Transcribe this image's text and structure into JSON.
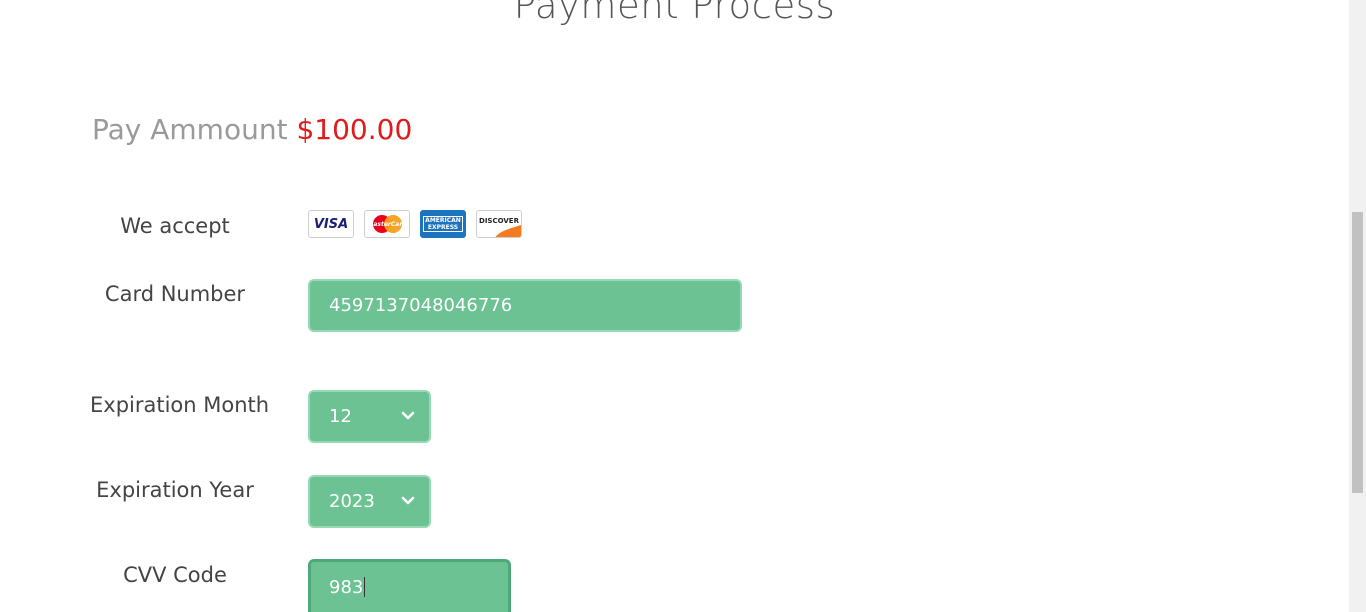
{
  "page": {
    "title": "Payment Process"
  },
  "amount": {
    "label": "Pay Ammount",
    "value": "$100.00"
  },
  "accept": {
    "label": "We accept",
    "cards": [
      {
        "name": "visa",
        "text": "VISA"
      },
      {
        "name": "mastercard",
        "text": "MasterCard"
      },
      {
        "name": "amex",
        "text_line1": "AMERICAN",
        "text_line2": "EXPRESS"
      },
      {
        "name": "discover",
        "text": "DISCOVER"
      }
    ]
  },
  "card_number": {
    "label": "Card Number",
    "value": "4597137048046776"
  },
  "expiration_month": {
    "label": "Expiration Month",
    "value": "12",
    "icon": "chevron-down-icon"
  },
  "expiration_year": {
    "label": "Expiration Year",
    "value": "2023",
    "icon": "chevron-down-icon"
  },
  "cvv": {
    "label": "CVV Code",
    "value": "983"
  },
  "colors": {
    "field_bg": "#6cc293",
    "amount_red": "#e01b1b",
    "label_gray": "#9a9a9a"
  }
}
